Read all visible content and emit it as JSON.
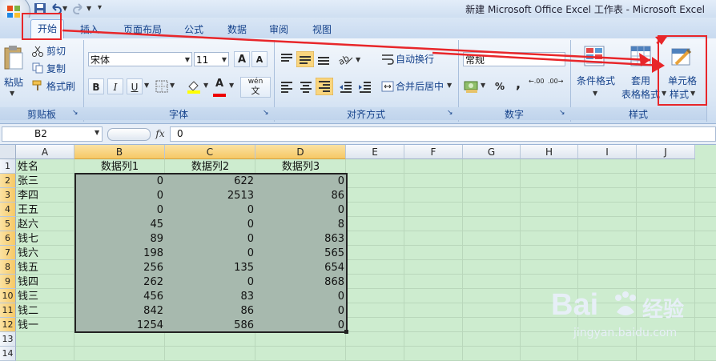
{
  "window": {
    "title": "新建 Microsoft Office Excel 工作表 - Microsoft Excel"
  },
  "tabs": [
    "开始",
    "插入",
    "页面布局",
    "公式",
    "数据",
    "审阅",
    "视图"
  ],
  "ribbon": {
    "clipboard": {
      "paste": "粘贴",
      "cut": "剪切",
      "copy": "复制",
      "format_painter": "格式刷",
      "label": "剪贴板"
    },
    "font": {
      "name": "宋体",
      "size": "11",
      "bold": "B",
      "italic": "I",
      "underline": "U",
      "font_color": "A",
      "wen": "wén",
      "wen_char": "文",
      "grow": "A",
      "shrink": "A",
      "label": "字体"
    },
    "alignment": {
      "wrap_text": "自动换行",
      "merge_center": "合并后居中",
      "label": "对齐方式"
    },
    "number": {
      "format": "常规",
      "percent": "%",
      "comma": ",",
      "inc_dec": ".00",
      "dec_dec": ".00",
      "label": "数字"
    },
    "styles": {
      "conditional_1": "条件格式",
      "table_1": "套用",
      "table_2": "表格格式",
      "cell_1": "单元格",
      "cell_2": "样式",
      "label": "样式"
    }
  },
  "formula_bar": {
    "name_box": "B2",
    "fx": "fx",
    "value": "0"
  },
  "grid": {
    "columns": [
      "A",
      "B",
      "C",
      "D",
      "E",
      "F",
      "G",
      "H",
      "I",
      "J"
    ],
    "rows": [
      "1",
      "2",
      "3",
      "4",
      "5",
      "6",
      "7",
      "8",
      "9",
      "10",
      "11",
      "12",
      "13",
      "14"
    ],
    "headers": [
      "姓名",
      "数据列1",
      "数据列2",
      "数据列3"
    ],
    "data": [
      [
        "张三",
        "0",
        "622",
        "0"
      ],
      [
        "李四",
        "0",
        "2513",
        "86"
      ],
      [
        "王五",
        "0",
        "0",
        "0"
      ],
      [
        "赵六",
        "45",
        "0",
        "8"
      ],
      [
        "钱七",
        "89",
        "0",
        "863"
      ],
      [
        "钱六",
        "198",
        "0",
        "565"
      ],
      [
        "钱五",
        "256",
        "135",
        "654"
      ],
      [
        "钱四",
        "262",
        "0",
        "868"
      ],
      [
        "钱三",
        "456",
        "83",
        "0"
      ],
      [
        "钱二",
        "842",
        "86",
        "0"
      ],
      [
        "钱一",
        "1254",
        "586",
        "0"
      ]
    ]
  },
  "watermark": {
    "brand": "Bai",
    "brand_tail": "经验",
    "url": "jingyan.baidu.com"
  },
  "colors": {
    "annotation": "#e8262a",
    "grid_bg": "#cdeccf",
    "selection": "#a7b9ae"
  }
}
